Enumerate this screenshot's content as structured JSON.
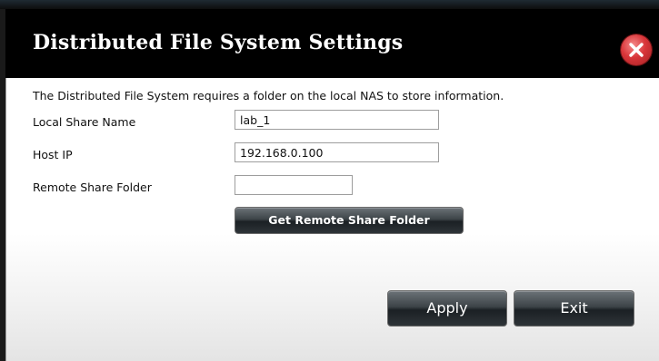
{
  "dialog": {
    "title": "Distributed File System Settings",
    "close_icon": "close-x-icon"
  },
  "form": {
    "intro": "The Distributed File System requires a folder on the local NAS to store information.",
    "local_share_name_label": "Local Share Name",
    "local_share_name_value": "lab_1",
    "host_ip_label": "Host IP",
    "host_ip_value": "192.168.0.100",
    "remote_share_folder_label": "Remote Share Folder",
    "remote_share_folder_value": "",
    "get_remote_button": "Get Remote Share Folder"
  },
  "actions": {
    "apply_label": "Apply",
    "exit_label": "Exit"
  },
  "colors": {
    "title_bar": "#000000",
    "close_button": "#d9363a",
    "button_dark": "#2e3438"
  }
}
